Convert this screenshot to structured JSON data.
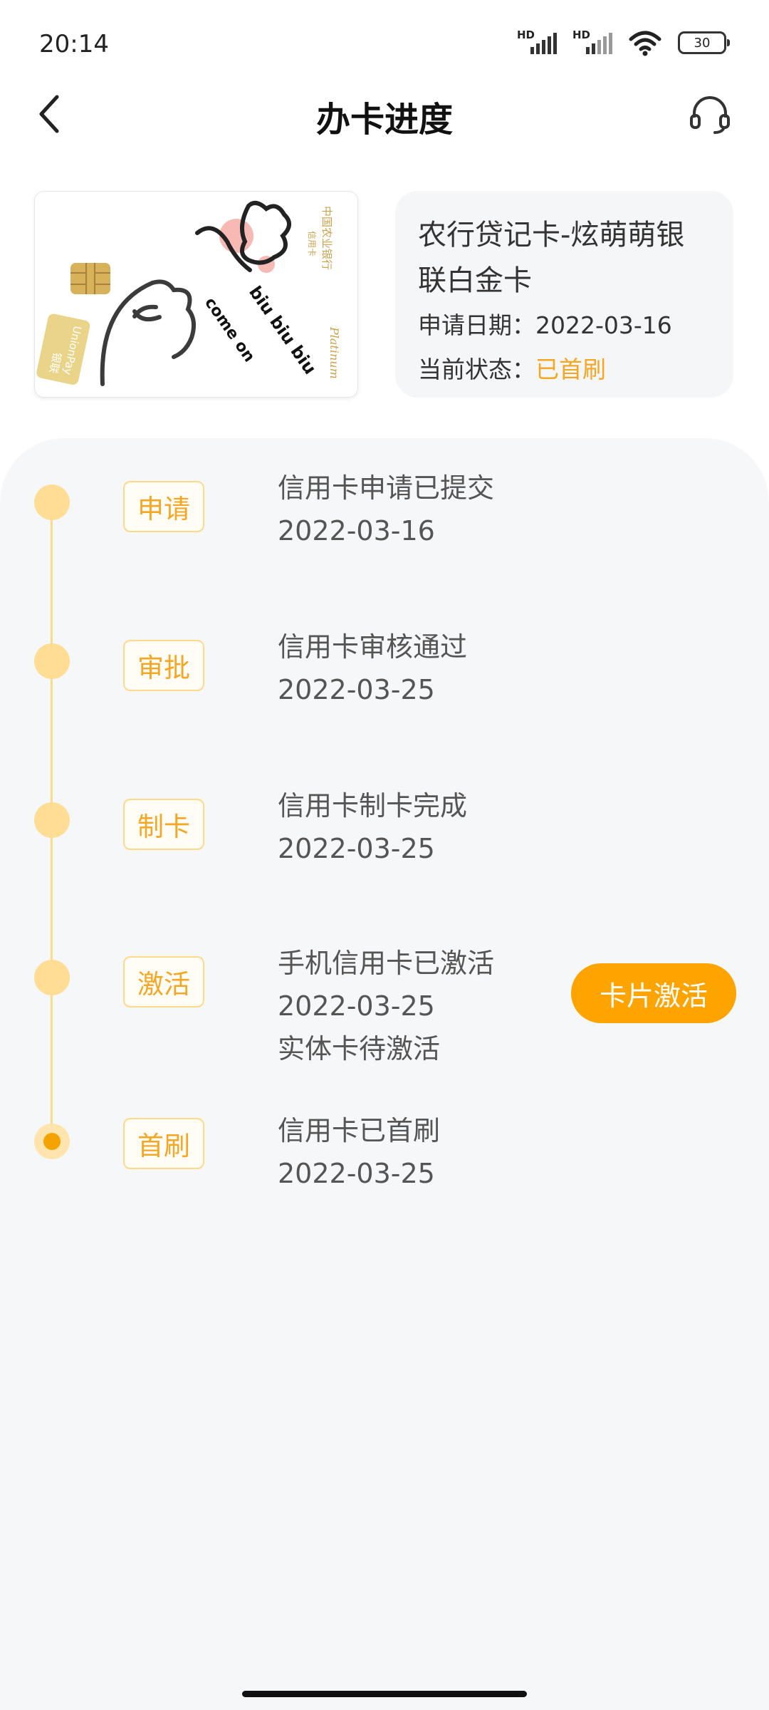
{
  "status_bar": {
    "time": "20:14",
    "sim1_label": "HD",
    "sim2_label": "HD",
    "battery": "30",
    "icons": [
      "signal-icon",
      "signal-icon",
      "wifi-icon",
      "battery-icon"
    ]
  },
  "header": {
    "title": "办卡进度",
    "back_icon": "chevron-left-icon",
    "service_icon": "headset-icon"
  },
  "card": {
    "image_texts": {
      "bank_name": "中国农业银行",
      "credit_label": "信用卡",
      "doodle_text_1": "biu biu biu",
      "doodle_text_2": "come on",
      "brand": "UnionPay",
      "brand_cn": "银联",
      "grade": "Platinum"
    },
    "name": "农行贷记卡-炫萌萌银联白金卡",
    "apply_date_label": "申请日期：",
    "apply_date": "2022-03-16",
    "status_label": "当前状态：",
    "status_value": "已首刷",
    "accent_color": "#f5a623"
  },
  "timeline": {
    "steps": [
      {
        "badge": "申请",
        "lines": [
          "信用卡申请已提交",
          "2022-03-16"
        ],
        "current": false
      },
      {
        "badge": "审批",
        "lines": [
          "信用卡审核通过",
          "2022-03-25"
        ],
        "current": false
      },
      {
        "badge": "制卡",
        "lines": [
          "信用卡制卡完成",
          "2022-03-25"
        ],
        "current": false
      },
      {
        "badge": "激活",
        "lines": [
          "手机信用卡已激活",
          "2022-03-25",
          "实体卡待激活"
        ],
        "current": false
      },
      {
        "badge": "首刷",
        "lines": [
          "信用卡已首刷",
          "2022-03-25"
        ],
        "current": true
      }
    ],
    "activate_button": "卡片激活",
    "button_color": "#fda400"
  }
}
